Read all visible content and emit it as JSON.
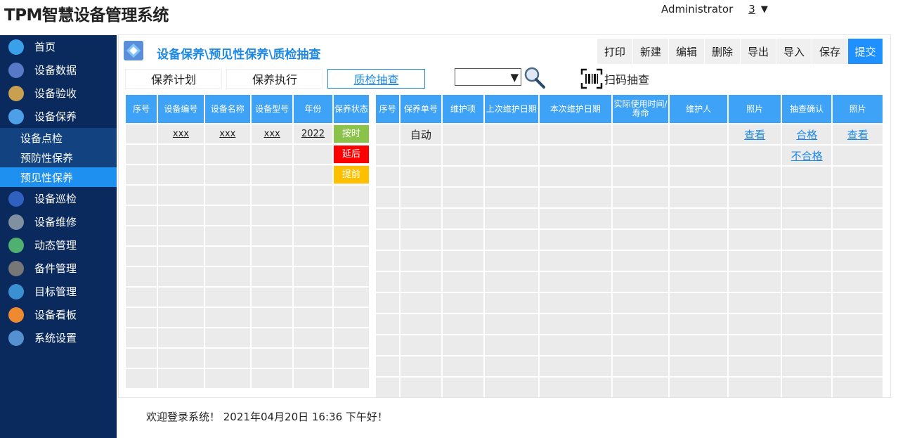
{
  "app": {
    "title": "TPM智慧设备管理系统",
    "user": "Administrator",
    "user_count": "3",
    "caret": "▼"
  },
  "sidebar": {
    "items": [
      {
        "label": "首页",
        "icon": "home-icon",
        "color": "#3aa0ea"
      },
      {
        "label": "设备数据",
        "icon": "data-icon",
        "color": "#5878c8"
      },
      {
        "label": "设备验收",
        "icon": "checklist-icon",
        "color": "#c8a050"
      },
      {
        "label": "设备保养",
        "icon": "maintenance-icon",
        "color": "#4da0e8"
      }
    ],
    "sub_items": [
      {
        "label": "设备点检"
      },
      {
        "label": "预防性保养"
      },
      {
        "label": "预见性保养"
      }
    ],
    "items2": [
      {
        "label": "设备巡检",
        "icon": "clipboard-icon",
        "color": "#3060c0"
      },
      {
        "label": "设备维修",
        "icon": "tools-icon",
        "color": "#8090a0"
      },
      {
        "label": "动态管理",
        "icon": "network-icon",
        "color": "#50b070"
      },
      {
        "label": "备件管理",
        "icon": "inventory-icon",
        "color": "#777777"
      },
      {
        "label": "目标管理",
        "icon": "target-icon",
        "color": "#3a90d0"
      },
      {
        "label": "设备看板",
        "icon": "dashboard-icon",
        "color": "#f08a30"
      },
      {
        "label": "系统设置",
        "icon": "gear-icon",
        "color": "#5590d0"
      }
    ]
  },
  "breadcrumb": "设备保养\\预见性保养\\质检抽查",
  "toolbar": {
    "print": "打印",
    "new": "新建",
    "edit": "编辑",
    "delete": "删除",
    "export": "导出",
    "import": "导入",
    "save": "保存",
    "submit": "提交"
  },
  "tabs": [
    "保养计划",
    "保养执行",
    "质检抽查"
  ],
  "filter": {
    "caret": "▼"
  },
  "scan_label": "扫码抽查",
  "left_table": {
    "headers": [
      "序号",
      "设备编号",
      "设备名称",
      "设备型号",
      "年份",
      "保养状态"
    ],
    "row1": {
      "code": "xxx",
      "name": "xxx",
      "model": "xxx",
      "year": "2022"
    },
    "status_badges": [
      {
        "label": "按时",
        "color": "#8bc34a"
      },
      {
        "label": "延后",
        "color": "#ff0000"
      },
      {
        "label": "提前",
        "color": "#ffc000"
      }
    ]
  },
  "right_table": {
    "headers": [
      "序号",
      "保养单号",
      "维护项",
      "上次维护日期",
      "本次维护日期",
      "实际使用时间/寿命",
      "维护人",
      "照片",
      "抽查确认",
      "照片"
    ],
    "row1": {
      "order_no": "自动",
      "view1": "查看",
      "pass": "合格",
      "view2": "查看"
    },
    "row2": {
      "fail": "不合格"
    }
  },
  "welcome": "欢迎登录系统！ 2021年04月20日 16:36 下午好！"
}
